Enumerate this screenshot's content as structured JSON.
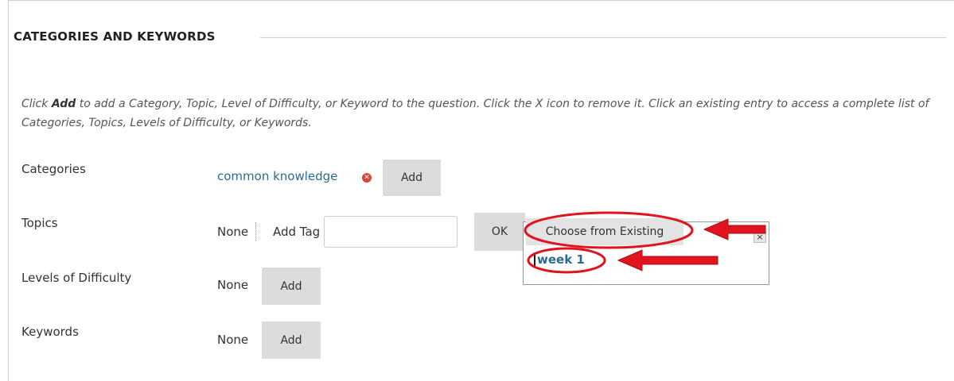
{
  "section": {
    "title": "CATEGORIES AND KEYWORDS"
  },
  "instructions": {
    "before": "Click ",
    "bold": "Add",
    "after": " to add a Category, Topic, Level of Difficulty, or Keyword to the question. Click the X icon to remove it. Click an existing entry to access a complete list of Categories, Topics, Levels of Difficulty, or Keywords."
  },
  "rows": {
    "categories": {
      "label": "Categories",
      "value": "common knowledge",
      "add_label": "Add"
    },
    "topics": {
      "label": "Topics",
      "value": "None",
      "add_tag_label": "Add Tag",
      "input_value": "",
      "ok_label": "OK"
    },
    "difficulty": {
      "label": "Levels of Difficulty",
      "value": "None",
      "add_label": "Add"
    },
    "keywords": {
      "label": "Keywords",
      "value": "None",
      "add_label": "Add"
    }
  },
  "popup": {
    "choose_label": "Choose from Existing",
    "close_label": "×",
    "options": [
      "week 1"
    ]
  },
  "icons": {
    "remove": "remove-circle-icon",
    "close": "close-icon",
    "arrow": "red-arrow-icon"
  },
  "colors": {
    "link": "#2c6a94",
    "remove_icon": "#d9453c",
    "button_bg": "#dcdcdc",
    "annotation": "#e0141e"
  }
}
